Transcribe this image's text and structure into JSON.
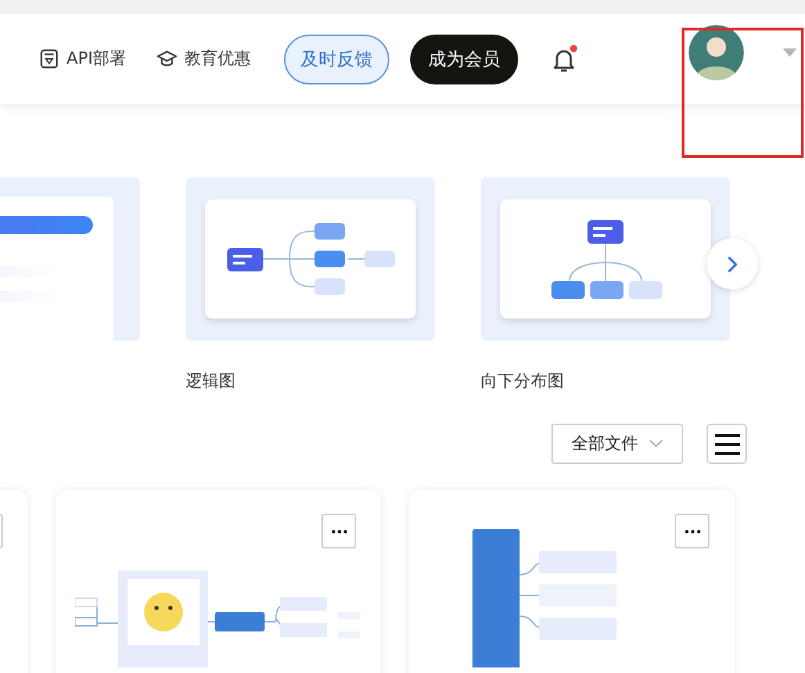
{
  "header": {
    "nav": [
      {
        "kind": "api",
        "label": "API部署"
      },
      {
        "kind": "edu",
        "label": "教育优惠"
      }
    ],
    "feedback_button": "及时反馈",
    "member_button": "成为会员",
    "notification": {
      "unread": true
    }
  },
  "templates": [
    {
      "kind": "partial"
    },
    {
      "kind": "logic",
      "label": "逻辑图"
    },
    {
      "kind": "tree",
      "label": "向下分布图"
    }
  ],
  "filter": {
    "value": "全部文件"
  },
  "files": [
    {
      "kind": "partial"
    },
    {
      "kind": "sun-map"
    },
    {
      "kind": "vertical-map"
    }
  ]
}
